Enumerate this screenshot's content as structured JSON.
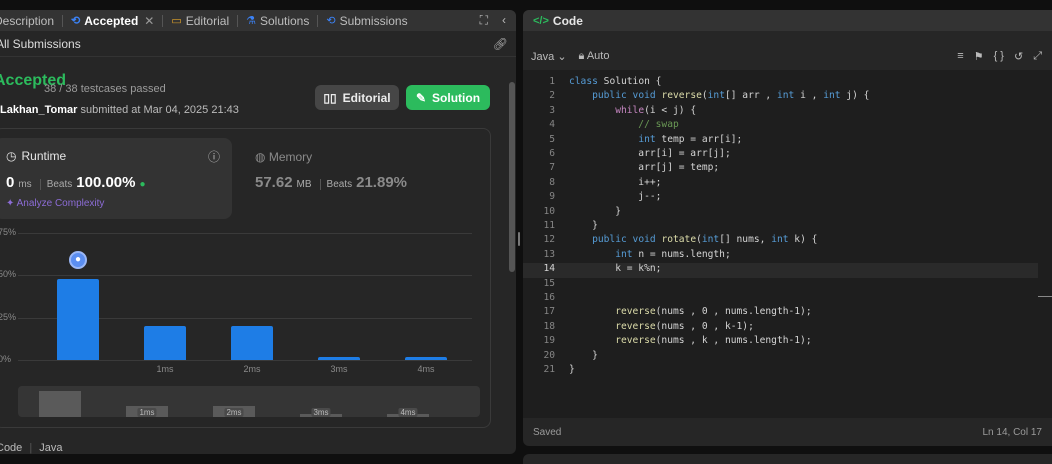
{
  "left_tabs": [
    {
      "label": "Description"
    },
    {
      "label": "Accepted"
    },
    {
      "label": "Editorial"
    },
    {
      "label": "Solutions"
    },
    {
      "label": "Submissions"
    }
  ],
  "subbar": {
    "title": "All Submissions"
  },
  "submission": {
    "status": "Accepted",
    "testcases": "38 / 38 testcases passed",
    "user": "Lakhan_Tomar",
    "submitted_text": " submitted at Mar 04, 2025 21:43"
  },
  "buttons": {
    "editorial": "Editorial",
    "solution": "Solution"
  },
  "runtime": {
    "title": "Runtime",
    "value": "0",
    "unit": "ms",
    "beats_label": "Beats",
    "beats_value": "100.00%",
    "analyze": "Analyze Complexity"
  },
  "memory": {
    "title": "Memory",
    "value": "57.62",
    "unit": "MB",
    "beats_label": "Beats",
    "beats_value": "21.89%"
  },
  "chart_data": {
    "type": "bar",
    "y_ticks": [
      "75%",
      "50%",
      "25%",
      "0%"
    ],
    "ylim": [
      0,
      75
    ],
    "categories": [
      "",
      "1ms",
      "2ms",
      "3ms",
      "4ms"
    ],
    "values": [
      48,
      20,
      20,
      2,
      2
    ],
    "color": "#1e7de6",
    "minimap_labels": [
      "1ms",
      "2ms",
      "3ms",
      "4ms"
    ]
  },
  "footer": {
    "left": "Code",
    "lang": "Java"
  },
  "code_panel": {
    "title": "Code",
    "language": "Java",
    "mode": "Auto",
    "status": "Saved",
    "cursor": "Ln 14, Col 17"
  },
  "code_lines": [
    "class Solution {",
    "    public void reverse(int[] arr , int i , int j) {",
    "        while(i < j) {",
    "            // swap",
    "            int temp = arr[i];",
    "            arr[i] = arr[j];",
    "            arr[j] = temp;",
    "            i++;",
    "            j--;",
    "        }",
    "    }",
    "    public void rotate(int[] nums, int k) {",
    "        int n = nums.length;",
    "        k = k%n;",
    "",
    "",
    "        reverse(nums , 0 , nums.length-1);",
    "        reverse(nums , 0 , k-1);",
    "        reverse(nums , k , nums.length-1);",
    "    }",
    "}"
  ]
}
